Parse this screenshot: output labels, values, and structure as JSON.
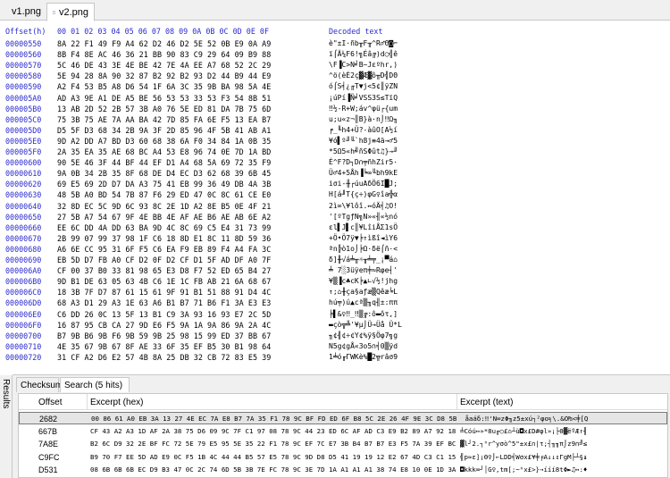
{
  "tabs": [
    {
      "label": "v1.png",
      "active": false
    },
    {
      "label": "v2.png",
      "active": true
    }
  ],
  "hex": {
    "header": {
      "offset": "Offset(h)",
      "columns": [
        "00",
        "01",
        "02",
        "03",
        "04",
        "05",
        "06",
        "07",
        "08",
        "09",
        "0A",
        "0B",
        "0C",
        "0D",
        "0E",
        "0F"
      ],
      "decoded": "Decoded text"
    },
    "rows": [
      {
        "off": "00000550",
        "bytes": "8A 22 F1 49 F9 A4 62 D2 46 D2 5E 52 0B E9 0A A9",
        "txt": "è\"±I·ñb╥F╥^R♂Θ◙⌐"
      },
      {
        "off": "00000560",
        "bytes": "8B F4 8E AC 46 36 21 BB 90 83 C9 29 64 09 B9 88",
        "txt": "ï⌠Ä¼F6!╗Éâ╔)d○╣ê"
      },
      {
        "off": "00000570",
        "bytes": "5C 46 DE 43 3E 4E BE 42 7E 4A EE A7 68 52 2C 29",
        "txt": "\\F▐C>N╛B~Jεºhr,)"
      },
      {
        "off": "00000580",
        "bytes": "5E 94 28 8A 90 32 87 B2 92 B2 93 D2 44 B9 44 E9",
        "txt": "^ö(èÉ2ç▓Æ▓ô╥D╣DΘ"
      },
      {
        "off": "00000590",
        "bytes": "A2 F4 53 B5 A8 D6 54 1F 6A 3C 35 9B BA 98 5A 4E",
        "txt": "ó⌠S╡¿╓T▼j<5¢║ÿZN"
      },
      {
        "off": "000005A0",
        "bytes": "AD A3 9E A1 DE A5 BE 56 53 53 33 53 F3 54 8B 51",
        "txt": "¡úPí▐Ñ╛VSS3S≤TïQ"
      },
      {
        "off": "000005B0",
        "bytes": "13 AB 2D 52 2B 57 3B A0 76 5E ED 81 DA 7B 75 6D",
        "txt": "‼½-R+W;áv^φü┌{um"
      },
      {
        "off": "000005C0",
        "bytes": "75 3B 75 AE 7A AA BA 42 7D 85 FA 6E F5 13 EA B7",
        "txt": "u;u«z¬║B}à·n⌡‼Ω╖"
      },
      {
        "off": "000005D0",
        "bytes": "D5 5F D3 68 34 2B 9A 3F 2D 85 96 4F 5B 41 AB A1",
        "txt": "╒_╙h4+Ü?-àûO[A½í"
      },
      {
        "off": "000005E0",
        "bytes": "9D A2 DD A7 BD D3 60 68 38 6A F0 34 84 1A 0B 35",
        "txt": "¥ó▌º╜╙`h8j≡4ä→♂5"
      },
      {
        "off": "000005F0",
        "bytes": "2A 35 EA 35 AE 68 BC A4 53 E8 96 74 0E 7D 1A BD",
        "txt": "*5Ω5«h╝ñSΦût♫}→╜"
      },
      {
        "off": "00000600",
        "bytes": "90 5E 46 3F 44 BF 44 EF D1 A4 68 5A 69 72 35 F9",
        "txt": "É^F?D┐D∩╤ñhZir5·"
      },
      {
        "off": "00000610",
        "bytes": "9A 0B 34 2B 35 8F 68 DE D4 EC D3 62 68 39 6B 45",
        "txt": "Ü♂4+5Åh▐╘∞╙bh9kE"
      },
      {
        "off": "00000620",
        "bytes": "69 E5 69 2D D7 DA A3 75 41 EB 99 36 49 DB 4A 3B",
        "txt": "iσi-╫┌úuAδÖ6I█J;"
      },
      {
        "off": "00000630",
        "bytes": "48 5B A0 BD 54 7B 87 F6 29 ED 47 0C 8C 61 CE E0",
        "txt": "H[á╜T{ç÷)φG♀îa╬α"
      },
      {
        "off": "00000640",
        "bytes": "32 8D EC 5C 9D 6C 93 8C 2E 1D A2 8E B5 0E 4F 21",
        "txt": "2ì∞\\¥lôî.↔óÄ╡♫O!"
      },
      {
        "off": "00000650",
        "bytes": "27 5B A7 54 67 9F 4E BB 4E AF AE B6 AE AB 6E A2",
        "txt": "'[ºTgƒN╗N»«╢«½nó"
      },
      {
        "off": "00000660",
        "bytes": "EE 6C DD 4A DD 63 BA 9D 4C 8C 69 C5 E4 31 73 99",
        "txt": "εl▌J▌c║¥LîiÅΣ1sÖ"
      },
      {
        "off": "00000670",
        "bytes": "2B 99 07 99 37 98 1F C6 18 8D E1 8C 11 8D 59 36",
        "txt": "+Ö•Ö7ÿ▼╞↑ìßî◄ìY6"
      },
      {
        "off": "00000680",
        "bytes": "A6 6E CC 95 31 6F F5 C6 EA F9 EB 89 F4 A4 FA 3C",
        "txt": "ªn╠ò1o⌡╞Ω·δë⌠ñ·<"
      },
      {
        "off": "00000690",
        "bytes": "EB 5D D7 FB A0 CF D2 0F D2 CF D1 5F AD DF A0 7F",
        "txt": "δ]╫√á╧╥☼╥╧╤_¡▀á⌂"
      },
      {
        "off": "000006A0",
        "bytes": "CF 00 37 B0 33 81 98 65 E3 D8 F7 52 ED 65 B4 27",
        "txt": "╧ 7░3üÿeπ╪≈Rφe┤'"
      },
      {
        "off": "000006B0",
        "bytes": "9D B1 DE 63 05 63 4B C6 1E 1C FB AB 21 6A 68 67",
        "txt": "¥▒▐c♣cK╞▲∟√½!jhg"
      },
      {
        "off": "000006C0",
        "bytes": "18 3B 7F D7 87 61 15 61 9F 91 B1 51 88 91 D4 4C",
        "txt": "↑;⌂╫ça§aƒæ▒Qêæ╘L"
      },
      {
        "off": "000006D0",
        "bytes": "68 A3 D1 29 A3 1E 63 A6 B1 B7 71 B6 F1 3A E3 E3",
        "txt": "hú╤)ú▲cª▒╖q╢±:ππ"
      },
      {
        "off": "000006E0",
        "bytes": "C6 DD 26 0C 13 5F 13 B1 C9 3A 93 16 93 E7 2C 5D",
        "txt": "╞▌&♀‼_‼▒╔:ô▬ôτ,]"
      },
      {
        "off": "000006F0",
        "bytes": "16 87 95 CB CA 27 9D E6 F5 9A 1A 9A 86 9A 2A 4C",
        "txt": "▬çò╦╩'¥µ⌡Ü→Üå Ü*L"
      },
      {
        "off": "00000700",
        "bytes": "B7 9B B6 9B F6 9B 59 9B 25 98 15 99 ED 37 BB 67",
        "txt": "╖¢╢¢÷¢Y¢%ÿ§Öφ7╗g"
      },
      {
        "off": "00000710",
        "bytes": "4E 35 67 9B 67 8F AE 33 6F 35 EF B5 30 B1 98 64",
        "txt": "N5g¢gÅ«3o5∩╡0▒ÿd"
      },
      {
        "off": "00000720",
        "bytes": "31 CF A2 D6 E2 57 4B 8A 25 DB 32 CB 72 83 E5 39",
        "txt": "1╧ó╓ΓWKè%█2╦râσ9"
      }
    ]
  },
  "results": {
    "side_label": "Results",
    "tabs": [
      {
        "label": "Checksum",
        "active": false
      },
      {
        "label": "Search (5 hits)",
        "active": true
      }
    ],
    "columns": {
      "offset": "Offset",
      "hex": "Excerpt (hex)",
      "text": "Excerpt (text)"
    },
    "rows": [
      {
        "offset": "2682",
        "hex": "00 86 61 A0 EB 3A 13 27 4E EC 7A E8 B7 7A 35 F1 78 9C BF FD ED 6F B8 5C 2E 26 4F 9E 3C D8 5B 51",
        "text": " åaáδ:‼'N∞zΦ╖z5±xú┐²φo╕\\.&O₧<╪[Q",
        "selected": true
      },
      {
        "offset": "667B",
        "hex": "CF 43 A2 A3 1D AF 2A 38 75 D6 09 9C 7F C1 97 08 78 9C 44 23 ED 6C AF AD C3 E9 B2 89 A7 92 18 B6",
        "text": "╧Cóú↔»*8u╓○£⌂┴ù◘x£D#φl»¡├Θ▓ëºÆ↑╢",
        "selected": false
      },
      {
        "offset": "7A8E",
        "hex": "B2 6C D9 32 2E BF FC 72 5E 79 E5 95 5E 35 22 F1 78 9C EF 7C E7 3B B4 B7 B7 E3 F5 7A 39 EF BC F3",
        "text": "▓l┘2.┐ⁿr^yσò^5\"±x£∩|τ;┤╖╖π⌡z9∩╝≤",
        "selected": false
      },
      {
        "offset": "C9FC",
        "hex": "B9 70 F7 EE 5D AD E9 0C F5 1B 4C 44 44 B5 57 E5 78 9C 9D D8 D5 41 19 19 12 E2 67 4D C3 C1 15 17",
        "text": "╣p≈ε]¡Θ♀⌡←LDD╡Wσx£¥╪╒A↓↓↕ΓgM├┴§↨",
        "selected": false
      },
      {
        "offset": "D531",
        "hex": "08 6B 6B 6B EC D9 B3 47 0C 2C 74 6D 5B 3B 7E FC 78 9C 3E 7D 1A A1 A1 A1 38 74 E8 10 0E 1D 3A 04",
        "text": "◘kkk∞┘│G♀,tm[;~ⁿx£>}→ííí8tΦ►♫↔:♦",
        "selected": false
      }
    ]
  }
}
